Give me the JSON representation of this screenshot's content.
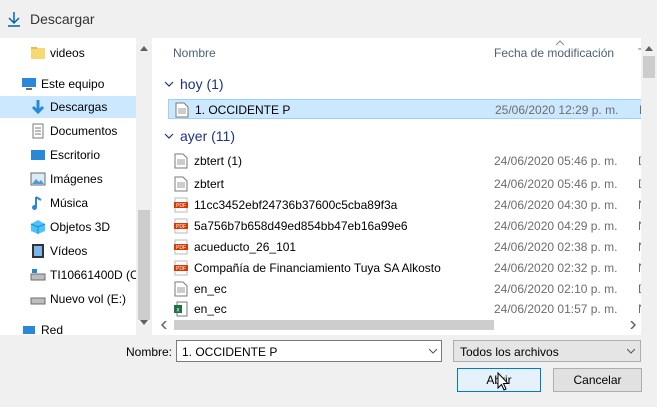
{
  "window": {
    "title": "Descargar"
  },
  "sidebar": {
    "items": [
      {
        "label": "videos",
        "icon": "folder-icon"
      },
      {
        "label": "Este equipo",
        "icon": "computer-icon"
      },
      {
        "label": "Descargas",
        "icon": "download-arrow-icon",
        "selected": true
      },
      {
        "label": "Documentos",
        "icon": "document-icon"
      },
      {
        "label": "Escritorio",
        "icon": "desktop-icon"
      },
      {
        "label": "Imágenes",
        "icon": "pictures-icon"
      },
      {
        "label": "Música",
        "icon": "music-icon"
      },
      {
        "label": "Objetos 3D",
        "icon": "3d-objects-icon"
      },
      {
        "label": "Vídeos",
        "icon": "video-icon"
      },
      {
        "label": "TI10661400D (C:)",
        "icon": "drive-icon"
      },
      {
        "label": "Nuevo vol (E:)",
        "icon": "drive-icon"
      },
      {
        "label": "Red",
        "icon": "network-icon"
      }
    ]
  },
  "columns": {
    "name": "Nombre",
    "date": "Fecha de modificación",
    "type": "T"
  },
  "groups": [
    {
      "label": "hoy (1)",
      "rows": [
        {
          "name": "1. OCCIDENTE P",
          "date": "25/06/2020 12:29 p. m.",
          "type": "D",
          "icon": "text-file-icon",
          "selected": true
        }
      ]
    },
    {
      "label": "ayer (11)",
      "rows": [
        {
          "name": "zbtert (1)",
          "date": "24/06/2020 05:46 p. m.",
          "type": "D",
          "icon": "text-file-icon"
        },
        {
          "name": "zbtert",
          "date": "24/06/2020 05:46 p. m.",
          "type": "D",
          "icon": "text-file-icon"
        },
        {
          "name": "11cc3452ebf24736b37600c5cba89f3a",
          "date": "24/06/2020 04:30 p. m.",
          "type": "N",
          "icon": "pdf-icon"
        },
        {
          "name": "5a756b7b658d49ed854bb47eb16a99e6",
          "date": "24/06/2020 04:29 p. m.",
          "type": "N",
          "icon": "pdf-icon"
        },
        {
          "name": "acueducto_26_101",
          "date": "24/06/2020 02:38 p. m.",
          "type": "N",
          "icon": "pdf-icon"
        },
        {
          "name": "Compañía de Financiamiento Tuya SA Alkosto",
          "date": "24/06/2020 02:32 p. m.",
          "type": "N",
          "icon": "pdf-icon"
        },
        {
          "name": "en_ec",
          "date": "24/06/2020 02:10 p. m.",
          "type": "D",
          "icon": "text-file-icon"
        },
        {
          "name": "en_ec",
          "date": "24/06/2020 01:57 p. m.",
          "type": "N",
          "icon": "excel-icon"
        }
      ]
    }
  ],
  "footer": {
    "name_label": "Nombre:",
    "name_value": "1. OCCIDENTE P",
    "filter_value": "Todos los archivos",
    "open_label": "Abrir",
    "cancel_label": "Cancelar"
  },
  "colors": {
    "selection": "#cce8ff",
    "group_text": "#1e3287",
    "accent": "#0078d7"
  }
}
